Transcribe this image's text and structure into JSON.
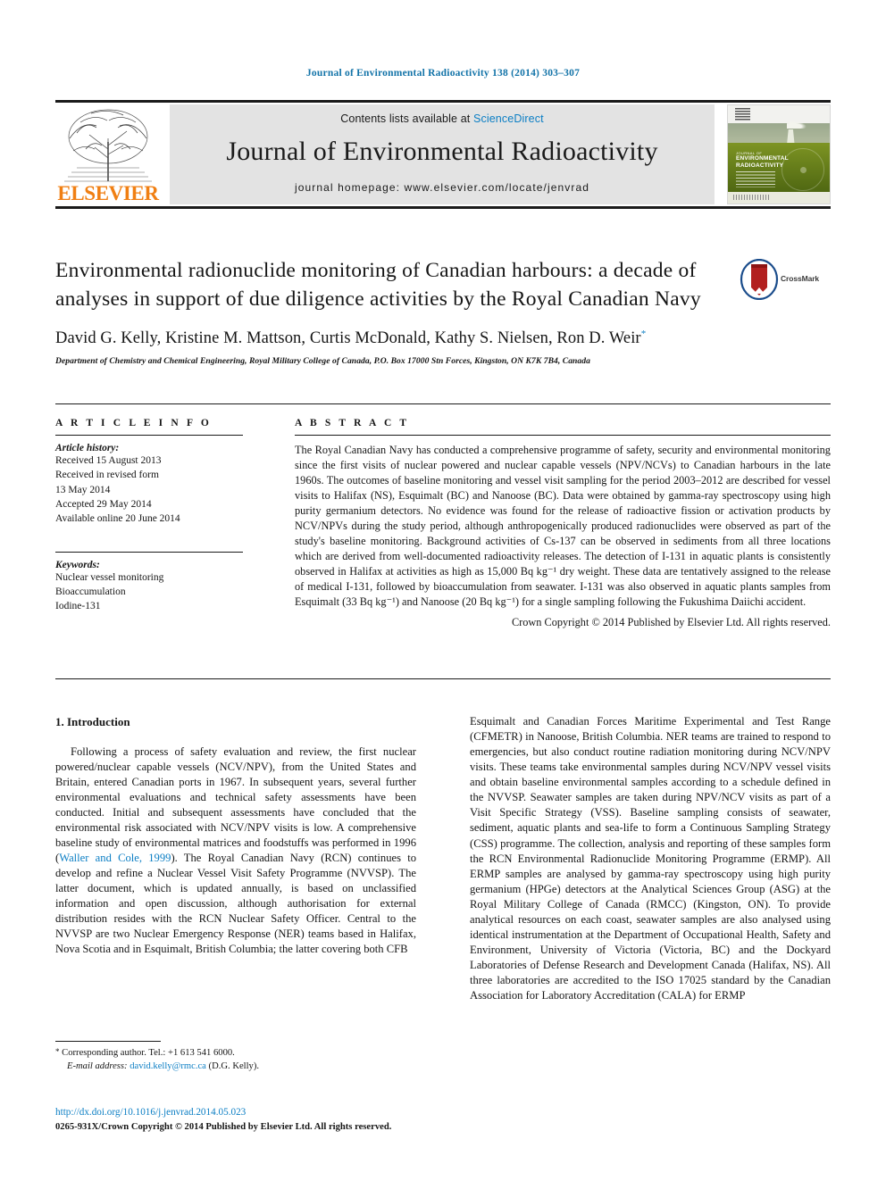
{
  "running_head": "Journal of Environmental Radioactivity 138 (2014) 303–307",
  "masthead": {
    "publisher_logo_text": "ELSEVIER",
    "contents_prefix": "Contents lists available at",
    "contents_link": "ScienceDirect",
    "journal_name": "Journal of Environmental Radioactivity",
    "homepage_line": "journal homepage: www.elsevier.com/locate/jenvrad",
    "cover_title_small": "JOURNAL OF",
    "cover_title_main": "ENVIRONMENTAL RADIOACTIVITY"
  },
  "article": {
    "title": "Environmental radionuclide monitoring of Canadian harbours: a decade of analyses in support of due diligence activities by the Royal Canadian Navy",
    "authors": "David G. Kelly, Kristine M. Mattson, Curtis McDonald, Kathy S. Nielsen, Ron D. Weir",
    "corresponding_marker": "*",
    "affiliation": "Department of Chemistry and Chemical Engineering, Royal Military College of Canada, P.O. Box 17000 Stn Forces, Kingston, ON K7K 7B4, Canada",
    "crossmark_label": "CrossMark"
  },
  "article_info": {
    "heading": "A R T I C L E   I N F O",
    "history_label": "Article history:",
    "history": [
      "Received 15 August 2013",
      "Received in revised form",
      "13 May 2014",
      "Accepted 29 May 2014",
      "Available online 20 June 2014"
    ],
    "keywords_label": "Keywords:",
    "keywords": [
      "Nuclear vessel monitoring",
      "Bioaccumulation",
      "Iodine-131"
    ]
  },
  "abstract": {
    "heading": "A B S T R A C T",
    "text": "The Royal Canadian Navy has conducted a comprehensive programme of safety, security and environmental monitoring since the first visits of nuclear powered and nuclear capable vessels (NPV/NCVs) to Canadian harbours in the late 1960s. The outcomes of baseline monitoring and vessel visit sampling for the period 2003–2012 are described for vessel visits to Halifax (NS), Esquimalt (BC) and Nanoose (BC). Data were obtained by gamma-ray spectroscopy using high purity germanium detectors. No evidence was found for the release of radioactive fission or activation products by NCV/NPVs during the study period, although anthropogenically produced radionuclides were observed as part of the study's baseline monitoring. Background activities of Cs-137 can be observed in sediments from all three locations which are derived from well-documented radioactivity releases. The detection of I-131 in aquatic plants is consistently observed in Halifax at activities as high as 15,000 Bq kg⁻¹ dry weight. These data are tentatively assigned to the release of medical I-131, followed by bioaccumulation from seawater. I-131 was also observed in aquatic plants samples from Esquimalt (33 Bq kg⁻¹) and Nanoose (20 Bq kg⁻¹) for a single sampling following the Fukushima Daiichi accident.",
    "copyright": "Crown Copyright © 2014 Published by Elsevier Ltd. All rights reserved."
  },
  "body": {
    "section_title": "1. Introduction",
    "left_paragraph_part1": "Following a process of safety evaluation and review, the first nuclear powered/nuclear capable vessels (NCV/NPV), from the United States and Britain, entered Canadian ports in 1967. In subsequent years, several further environmental evaluations and technical safety assessments have been conducted. Initial and subsequent assessments have concluded that the environmental risk associated with NCV/NPV visits is low. A comprehensive baseline study of environmental matrices and foodstuffs was performed in 1996 (",
    "left_citation": "Waller and Cole, 1999",
    "left_paragraph_part2": "). The Royal Canadian Navy (RCN) continues to develop and refine a Nuclear Vessel Visit Safety Programme (NVVSP). The latter document, which is updated annually, is based on unclassified information and open discussion, although authorisation for external distribution resides with the RCN Nuclear Safety Officer. Central to the NVVSP are two Nuclear Emergency Response (NER) teams based in Halifax, Nova Scotia and in Esquimalt, British Columbia; the latter covering both CFB",
    "right_paragraph": "Esquimalt and Canadian Forces Maritime Experimental and Test Range (CFMETR) in Nanoose, British Columbia. NER teams are trained to respond to emergencies, but also conduct routine radiation monitoring during NCV/NPV visits. These teams take environmental samples during NCV/NPV vessel visits and obtain baseline environmental samples according to a schedule defined in the NVVSP. Seawater samples are taken during NPV/NCV visits as part of a Visit Specific Strategy (VSS). Baseline sampling consists of seawater, sediment, aquatic plants and sea-life to form a Continuous Sampling Strategy (CSS) programme. The collection, analysis and reporting of these samples form the RCN Environmental Radionuclide Monitoring Programme (ERMP). All ERMP samples are analysed by gamma-ray spectroscopy using high purity germanium (HPGe) detectors at the Analytical Sciences Group (ASG) at the Royal Military College of Canada (RMCC) (Kingston, ON). To provide analytical resources on each coast, seawater samples are also analysed using identical instrumentation at the Department of Occupational Health, Safety and Environment, University of Victoria (Victoria, BC) and the Dockyard Laboratories of Defense Research and Development Canada (Halifax, NS). All three laboratories are accredited to the ISO 17025 standard by the Canadian Association for Laboratory Accreditation (CALA) for ERMP"
  },
  "footnotes": {
    "corresponding": "Corresponding author. Tel.: +1 613 541 6000.",
    "email_label": "E-mail address:",
    "email": "david.kelly@rmc.ca",
    "email_suffix": "(D.G. Kelly).",
    "doi": "http://dx.doi.org/10.1016/j.jenvrad.2014.05.023",
    "issn_line": "0265-931X/Crown Copyright © 2014 Published by Elsevier Ltd. All rights reserved."
  },
  "colors": {
    "link_blue": "#0b7ec4",
    "elsevier_orange": "#f07f13",
    "crossmark_red": "#b2201f",
    "cover_green": "#6f8c20"
  }
}
